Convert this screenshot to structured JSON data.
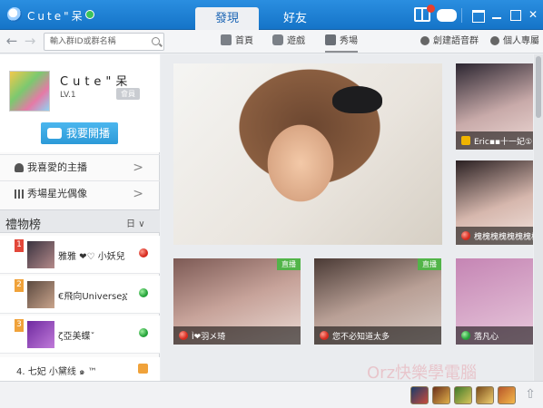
{
  "titlebar": {
    "username": "Cute\"呆",
    "tabs": [
      {
        "label": "發現",
        "active": true
      },
      {
        "label": "好友",
        "active": false
      }
    ]
  },
  "toolbar": {
    "search_placeholder": "輸入群ID或群名稱",
    "nav": [
      {
        "label": "首頁",
        "icon": "home-icon"
      },
      {
        "label": "遊戲",
        "icon": "gamepad-icon"
      },
      {
        "label": "秀場",
        "icon": "show-icon",
        "active": true
      }
    ],
    "actions": [
      {
        "label": "創建語音群",
        "icon": "group-icon"
      },
      {
        "label": "個人專屬",
        "icon": "tag-icon"
      }
    ]
  },
  "profile": {
    "name": "Cute\"呆",
    "level": "LV.1",
    "vip": "會員",
    "broadcast_label": "我要開播"
  },
  "sidebar": {
    "rows": [
      {
        "label": "我喜愛的主播",
        "icon": "person-icon"
      },
      {
        "label": "秀場星光偶像",
        "icon": "bar-chart-icon"
      }
    ],
    "gift_title": "禮物榜",
    "period": "日",
    "rankings": [
      {
        "rank": "1",
        "name": "雅雅 ❤♡ 小妖兒",
        "status": "red"
      },
      {
        "rank": "2",
        "name": "€飛向Universe፩",
        "status": "green"
      },
      {
        "rank": "3",
        "name": "ζ亞美蝶ˇ",
        "status": "green"
      },
      {
        "rank": "4.",
        "name": "七妃 小黛线 ๑ ™",
        "status": "crown"
      }
    ]
  },
  "streams": [
    {
      "caption": "Eric▪▪十一妃①",
      "live": false
    },
    {
      "caption": "槐槐槐槐槐槐槐槐",
      "live": false
    },
    {
      "caption": "Ì❤羽メ琦",
      "live": true,
      "live_label": "直播"
    },
    {
      "caption": "您不必知道太多",
      "live": true,
      "live_label": "直播"
    },
    {
      "caption": "落凡心",
      "live": false
    }
  ],
  "watermark": "Orz快樂學電腦",
  "colors": {
    "titlebar": "#1574c8",
    "accent_blue": "#2c9ad8",
    "live_green": "#52b449",
    "rank_red": "#e2473a",
    "rank_orange": "#f0a23a"
  }
}
